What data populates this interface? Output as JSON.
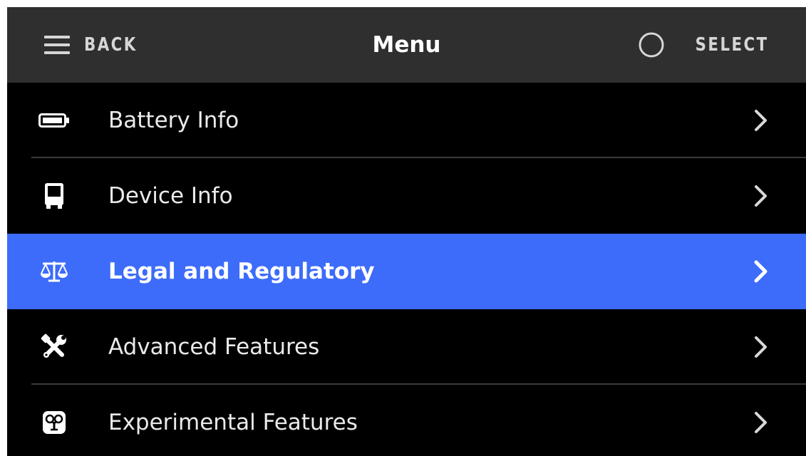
{
  "header": {
    "back_label": "BACK",
    "title": "Menu",
    "select_label": "SELECT"
  },
  "menu": {
    "items": [
      {
        "label": "Battery Info",
        "icon": "battery-icon",
        "selected": false
      },
      {
        "label": "Device Info",
        "icon": "device-icon",
        "selected": false
      },
      {
        "label": "Legal and Regulatory",
        "icon": "scales-icon",
        "selected": true
      },
      {
        "label": "Advanced Features",
        "icon": "tools-icon",
        "selected": false
      },
      {
        "label": "Experimental Features",
        "icon": "experimental-icon",
        "selected": false
      }
    ]
  },
  "colors": {
    "header_bg": "#2f2f2f",
    "screen_bg": "#000000",
    "highlight": "#3d6cfa",
    "text": "#eaeaea"
  }
}
